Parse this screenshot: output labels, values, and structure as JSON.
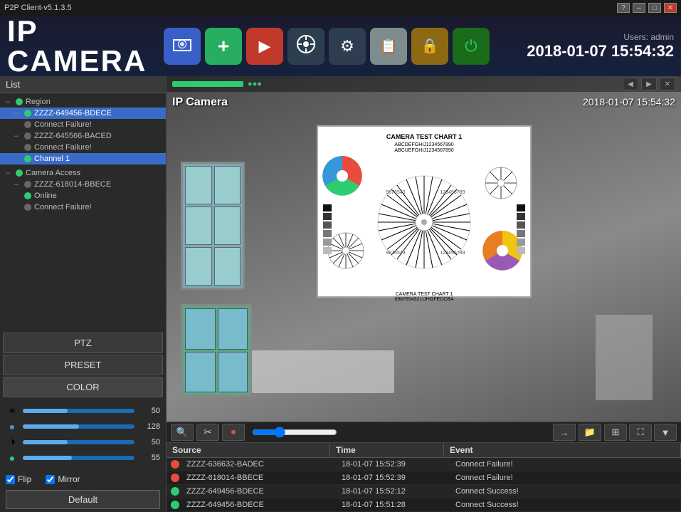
{
  "titlebar": {
    "title": "P2P Client-v5.1.3.5",
    "controls": [
      "?",
      "–",
      "□",
      "✕"
    ]
  },
  "header": {
    "logo_text": "IP CAMERA",
    "users_label": "Users: admin",
    "datetime": "2018-01-07  15:54:32",
    "toolbar_buttons": [
      {
        "id": "camera",
        "icon": "🎥",
        "style": "active"
      },
      {
        "id": "add",
        "icon": "➕",
        "style": "green"
      },
      {
        "id": "play",
        "icon": "▶",
        "style": "red"
      },
      {
        "id": "ptz",
        "icon": "🎯",
        "style": "nav"
      },
      {
        "id": "settings",
        "icon": "⚙",
        "style": "settings"
      },
      {
        "id": "files",
        "icon": "📄",
        "style": "files"
      },
      {
        "id": "lock",
        "icon": "🔒",
        "style": "lock"
      },
      {
        "id": "power",
        "icon": "⏻",
        "style": "power"
      }
    ]
  },
  "sidebar": {
    "list_label": "List",
    "tree_items": [
      {
        "id": "root1",
        "label": "Region",
        "indent": 0,
        "dot": "green",
        "type": "group"
      },
      {
        "id": "dev1",
        "label": "ZZZZ-649456-BDECE",
        "indent": 1,
        "dot": "green",
        "selected": true
      },
      {
        "id": "ch1",
        "label": "Connect Failure!",
        "indent": 2,
        "dot": "gray"
      },
      {
        "id": "dev2",
        "label": "ZZZZ-645566-BACED",
        "indent": 1,
        "dot": "gray"
      },
      {
        "id": "ch2",
        "label": "Connect Failure!",
        "indent": 2,
        "dot": "gray"
      },
      {
        "id": "selected_ch",
        "label": "Channel 1",
        "indent": 2,
        "dot": "green",
        "selected": true
      },
      {
        "id": "root2",
        "label": "Camera Access",
        "indent": 0,
        "dot": "green",
        "type": "group"
      },
      {
        "id": "dev3",
        "label": "ZZZZ-618014-BBECE",
        "indent": 1,
        "dot": "gray"
      },
      {
        "id": "ch3",
        "label": "Online",
        "indent": 2,
        "dot": "green"
      },
      {
        "id": "ch4",
        "label": "Connect Failure!",
        "indent": 2,
        "dot": "gray"
      }
    ],
    "buttons": [
      {
        "id": "ptz",
        "label": "PTZ"
      },
      {
        "id": "preset",
        "label": "PRESET"
      },
      {
        "id": "color",
        "label": "COLOR"
      }
    ],
    "color_controls": [
      {
        "id": "brightness",
        "icon": "☀",
        "value": 50,
        "fill_pct": 40
      },
      {
        "id": "hue",
        "icon": "🔵",
        "value": 128,
        "fill_pct": 50
      },
      {
        "id": "contrast",
        "icon": "◑",
        "value": 50,
        "fill_pct": 40
      },
      {
        "id": "saturation",
        "icon": "🟢",
        "value": 55,
        "fill_pct": 44
      }
    ],
    "flip_label": "Flip",
    "mirror_label": "Mirror",
    "flip_checked": true,
    "mirror_checked": true,
    "default_btn": "Default"
  },
  "feed": {
    "camera_label": "IP Camera",
    "camera_datetime": "2018-01-07  15:54:32",
    "status_bar_color": "#2ecc71"
  },
  "bottom_controls": {
    "buttons": [
      {
        "id": "zoom-in",
        "icon": "🔍"
      },
      {
        "id": "clip",
        "icon": "✂"
      },
      {
        "id": "rec",
        "icon": "⏺"
      },
      {
        "id": "arrow",
        "icon": "→"
      },
      {
        "id": "folder",
        "icon": "📁"
      }
    ],
    "view_buttons": [
      {
        "id": "grid",
        "icon": "⊞"
      },
      {
        "id": "fullscreen",
        "icon": "⛶"
      },
      {
        "id": "down",
        "icon": "▼"
      }
    ]
  },
  "event_log": {
    "columns": [
      "Source",
      "Time",
      "Event"
    ],
    "rows": [
      {
        "dot": "red",
        "source": "ZZZZ-636632-BADEC",
        "time": "18-01-07 15:52:39",
        "event": "Connect Failure!"
      },
      {
        "dot": "red",
        "source": "ZZZZ-618014-BBECE",
        "time": "18-01-07 15:52:39",
        "event": "Connect Failure!"
      },
      {
        "dot": "green",
        "source": "ZZZZ-649456-BDECE",
        "time": "18-01-07 15:52:12",
        "event": "Connect Success!"
      },
      {
        "dot": "green",
        "source": "ZZZZ-649456-BDECE",
        "time": "18-01-07 15:51:28",
        "event": "Connect Success!"
      }
    ]
  }
}
